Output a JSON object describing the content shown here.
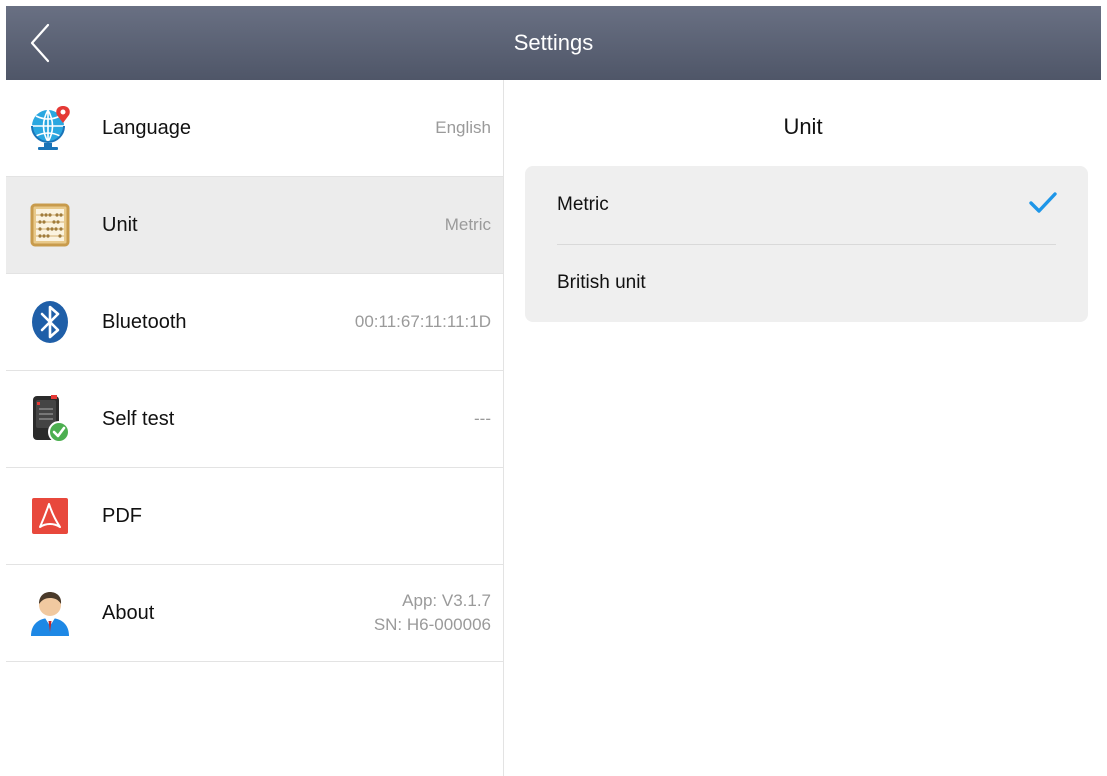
{
  "header": {
    "title": "Settings",
    "back_icon": "chevron-left-icon"
  },
  "sidebar": {
    "items": [
      {
        "label": "Language",
        "value": "English",
        "icon": "globe-pin-icon"
      },
      {
        "label": "Unit",
        "value": "Metric",
        "icon": "abacus-icon",
        "selected": true
      },
      {
        "label": "Bluetooth",
        "value": "00:11:67:11:11:1D",
        "icon": "bluetooth-icon"
      },
      {
        "label": "Self test",
        "value": "---",
        "icon": "device-check-icon"
      },
      {
        "label": "PDF",
        "value": "",
        "icon": "pdf-icon"
      },
      {
        "label": "About",
        "value_line1": "App: V3.1.7",
        "value_line2": "SN: H6-000006",
        "icon": "user-icon"
      }
    ]
  },
  "main": {
    "title": "Unit",
    "options": [
      {
        "label": "Metric",
        "checked": true
      },
      {
        "label": "British unit",
        "checked": false
      }
    ]
  },
  "colors": {
    "header_top": "#697083",
    "header_bottom": "#4f5668",
    "accent_check": "#1e96e8",
    "selected_row": "#ececec",
    "card_bg": "#efefef"
  }
}
